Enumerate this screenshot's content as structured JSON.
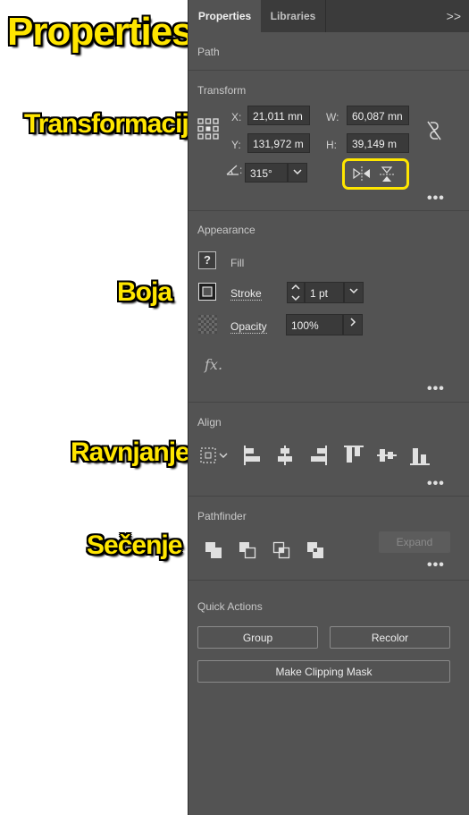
{
  "annotations": {
    "properties": "Properties",
    "transform": "Transformacija",
    "color": "Boja",
    "align": "Ravnjanje",
    "pathfinder": "Sečenje"
  },
  "tabs": {
    "properties": "Properties",
    "libraries": "Libraries",
    "more": ">>"
  },
  "path_label": "Path",
  "transform": {
    "title": "Transform",
    "x_label": "X:",
    "x_value": "21,011 mn",
    "y_label": "Y:",
    "y_value": "131,972 m",
    "w_label": "W:",
    "w_value": "60,087 mn",
    "h_label": "H:",
    "h_value": "39,149 m",
    "angle_label": ":",
    "angle_value": "315°"
  },
  "appearance": {
    "title": "Appearance",
    "fill_label": "Fill",
    "fill_symbol": "?",
    "stroke_label": "Stroke",
    "stroke_value": "1 pt",
    "opacity_label": "Opacity",
    "opacity_value": "100%",
    "fx_label": "fx."
  },
  "align": {
    "title": "Align"
  },
  "pathfinder": {
    "title": "Pathfinder",
    "expand_label": "Expand"
  },
  "quick_actions": {
    "title": "Quick Actions",
    "group_label": "Group",
    "recolor_label": "Recolor",
    "clipping_label": "Make Clipping Mask"
  },
  "more_dots": "•••",
  "colors": {
    "panel": "#535353",
    "tabbar": "#3b3b3b",
    "field": "#3a3a3a",
    "highlight": "#ffe600"
  }
}
